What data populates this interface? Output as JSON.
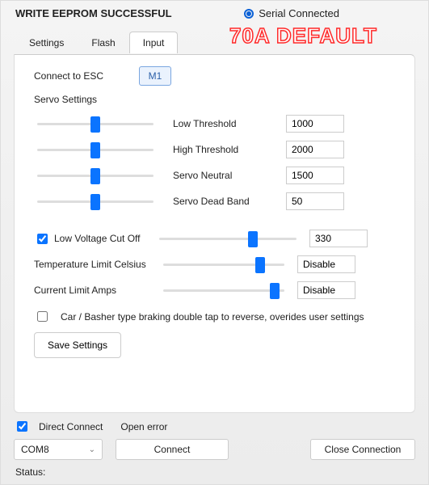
{
  "header": {
    "status_line": "WRITE EEPROM SUCCESSFUL",
    "serial_label": "Serial Connected",
    "overlay": "70A DEFAULT"
  },
  "tabs": {
    "settings": "Settings",
    "flash": "Flash",
    "input": "Input",
    "active": "input"
  },
  "input_panel": {
    "connect_label": "Connect to ESC",
    "esc_button": "M1",
    "servo_title": "Servo Settings",
    "sliders": {
      "low_threshold": {
        "label": "Low Threshold",
        "value": "1000",
        "pos": 50
      },
      "high_threshold": {
        "label": "High Threshold",
        "value": "2000",
        "pos": 50
      },
      "servo_neutral": {
        "label": "Servo Neutral",
        "value": "1500",
        "pos": 50
      },
      "servo_deadband": {
        "label": "Servo Dead Band",
        "value": "50",
        "pos": 50
      }
    },
    "low_voltage": {
      "checkbox_label": "Low Voltage Cut Off",
      "checked": true,
      "value": "330",
      "pos": 68
    },
    "temp_limit": {
      "label": "Temperature Limit Celsius",
      "value": "Disable",
      "pos": 80
    },
    "current_limit": {
      "label": "Current Limit Amps",
      "value": "Disable",
      "pos": 92
    },
    "car_mode": {
      "checked": false,
      "label": "Car / Basher type braking double tap to reverse, overides user settings"
    },
    "save_button": "Save Settings"
  },
  "bottom": {
    "direct_connect": {
      "label": "Direct Connect",
      "checked": true
    },
    "open_error": "Open error",
    "com_port": "COM8",
    "connect_btn": "Connect",
    "close_btn": "Close Connection",
    "status_label": "Status:"
  }
}
